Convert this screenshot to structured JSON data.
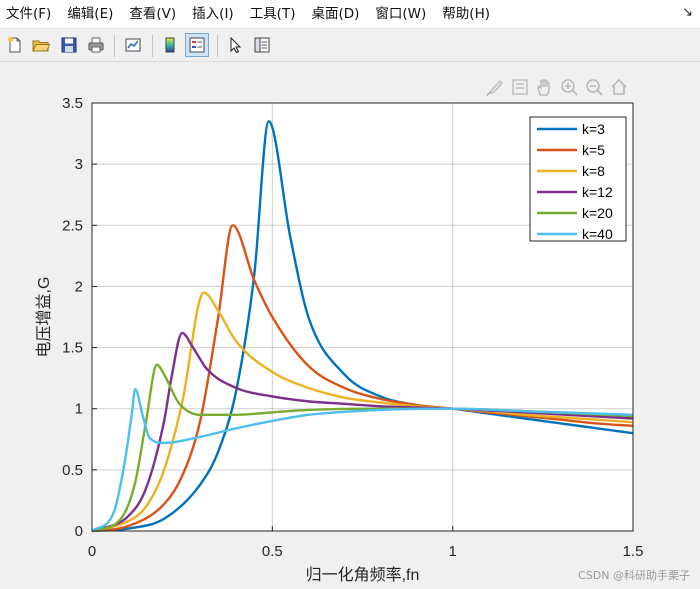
{
  "menu": {
    "items": [
      {
        "label": "文件(F)"
      },
      {
        "label": "编辑(E)"
      },
      {
        "label": "查看(V)"
      },
      {
        "label": "插入(I)"
      },
      {
        "label": "工具(T)"
      },
      {
        "label": "桌面(D)"
      },
      {
        "label": "窗口(W)"
      },
      {
        "label": "帮助(H)"
      }
    ],
    "dock_arrow": "↘"
  },
  "toolbar": {
    "buttons": [
      {
        "icon": "new-figure-icon"
      },
      {
        "icon": "open-file-icon"
      },
      {
        "icon": "save-icon"
      },
      {
        "icon": "print-icon"
      },
      {
        "icon": "link-plot-icon"
      },
      {
        "icon": "colorbar-icon"
      },
      {
        "icon": "legend-icon",
        "active": true
      },
      {
        "icon": "pointer-icon"
      },
      {
        "icon": "property-inspector-icon"
      }
    ]
  },
  "axes_toolbar": {
    "buttons": [
      "brush-icon",
      "datatip-icon",
      "pan-icon",
      "zoom-in-icon",
      "zoom-out-icon",
      "home-icon"
    ]
  },
  "colors": {
    "series": [
      "#0072BD",
      "#D95319",
      "#EDB120",
      "#7E2F8E",
      "#77AC30",
      "#4DBEEE"
    ],
    "grid": "#262626",
    "axes_bg": "#ffffff",
    "figure_bg": "#f0f0f0"
  },
  "chart_data": {
    "type": "line",
    "title": "",
    "xlabel": "归一化角频率,fn",
    "ylabel": "电压增益,G",
    "xlim": [
      0,
      1.5
    ],
    "ylim": [
      0,
      3.5
    ],
    "xticks": [
      0,
      0.5,
      1,
      1.5
    ],
    "xtick_labels": [
      "0",
      "0.5",
      "1",
      "1.5"
    ],
    "yticks": [
      0,
      0.5,
      1,
      1.5,
      2,
      2.5,
      3,
      3.5
    ],
    "ytick_labels": [
      "0",
      "0.5",
      "1",
      "1.5",
      "2",
      "2.5",
      "3",
      "3.5"
    ],
    "grid": true,
    "legend_position": "top-right",
    "series": [
      {
        "name": "k=3",
        "x": [
          0,
          0.1,
          0.2,
          0.3,
          0.35,
          0.4,
          0.45,
          0.49,
          0.55,
          0.6,
          0.7,
          0.8,
          0.9,
          1,
          1.1,
          1.2,
          1.3,
          1.4,
          1.5
        ],
        "y": [
          0,
          0.02,
          0.1,
          0.38,
          0.65,
          1.15,
          2.1,
          3.35,
          2.4,
          1.75,
          1.28,
          1.1,
          1.03,
          1,
          0.96,
          0.92,
          0.88,
          0.84,
          0.8
        ]
      },
      {
        "name": "k=5",
        "x": [
          0,
          0.1,
          0.2,
          0.25,
          0.3,
          0.35,
          0.39,
          0.45,
          0.5,
          0.6,
          0.7,
          0.8,
          0.9,
          1,
          1.1,
          1.2,
          1.3,
          1.4,
          1.5
        ],
        "y": [
          0,
          0.04,
          0.22,
          0.45,
          0.9,
          1.75,
          2.5,
          2.05,
          1.75,
          1.35,
          1.17,
          1.08,
          1.03,
          1,
          0.97,
          0.94,
          0.91,
          0.88,
          0.86
        ]
      },
      {
        "name": "k=8",
        "x": [
          0,
          0.1,
          0.15,
          0.2,
          0.25,
          0.31,
          0.35,
          0.4,
          0.5,
          0.6,
          0.7,
          0.8,
          0.9,
          1,
          1.1,
          1.2,
          1.3,
          1.4,
          1.5
        ],
        "y": [
          0,
          0.08,
          0.2,
          0.5,
          1.05,
          1.95,
          1.8,
          1.55,
          1.3,
          1.17,
          1.09,
          1.05,
          1.02,
          1,
          0.98,
          0.95,
          0.93,
          0.91,
          0.89
        ]
      },
      {
        "name": "k=12",
        "x": [
          0,
          0.1,
          0.15,
          0.2,
          0.22,
          0.25,
          0.28,
          0.32,
          0.4,
          0.5,
          0.6,
          0.7,
          0.8,
          0.9,
          1,
          1.2,
          1.5
        ],
        "y": [
          0,
          0.12,
          0.35,
          0.9,
          1.25,
          1.62,
          1.5,
          1.32,
          1.17,
          1.1,
          1.06,
          1.04,
          1.02,
          1.01,
          1,
          0.97,
          0.92
        ]
      },
      {
        "name": "k=20",
        "x": [
          0,
          0.08,
          0.12,
          0.15,
          0.18,
          0.2,
          0.24,
          0.3,
          0.4,
          0.5,
          0.6,
          0.8,
          1,
          1.2,
          1.5
        ],
        "y": [
          0,
          0.1,
          0.4,
          0.9,
          1.36,
          1.28,
          1.05,
          0.95,
          0.95,
          0.97,
          0.99,
          1,
          1,
          0.98,
          0.94
        ]
      },
      {
        "name": "k=40",
        "x": [
          0,
          0.06,
          0.09,
          0.11,
          0.12,
          0.14,
          0.16,
          0.2,
          0.3,
          0.4,
          0.5,
          0.6,
          0.8,
          1,
          1.2,
          1.5
        ],
        "y": [
          0,
          0.15,
          0.55,
          0.95,
          1.16,
          0.95,
          0.76,
          0.72,
          0.77,
          0.84,
          0.9,
          0.95,
          0.99,
          1,
          0.98,
          0.95
        ]
      }
    ]
  },
  "watermark": "CSDN @科研助手栗子"
}
